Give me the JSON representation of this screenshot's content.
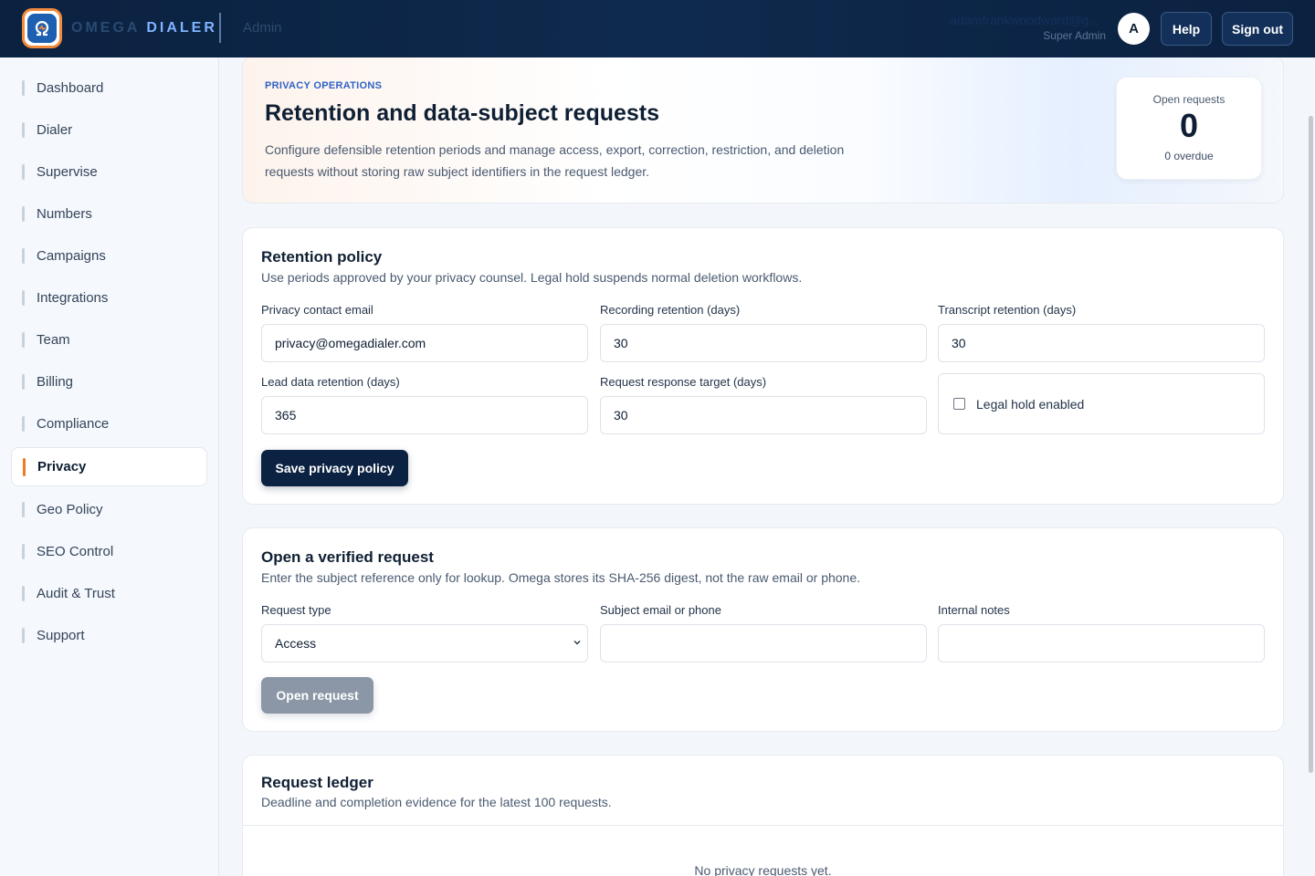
{
  "header": {
    "brand_first": "OMEGA",
    "brand_second": "DIALER",
    "area": "Admin",
    "user_email": "adamfrankwoodward@g...",
    "user_role": "Super Admin",
    "avatar_initial": "A",
    "help_label": "Help",
    "signout_label": "Sign out",
    "accent_color": "#f07b27"
  },
  "sidebar": {
    "items": [
      {
        "label": "Dashboard"
      },
      {
        "label": "Dialer"
      },
      {
        "label": "Supervise"
      },
      {
        "label": "Numbers"
      },
      {
        "label": "Campaigns"
      },
      {
        "label": "Integrations"
      },
      {
        "label": "Team"
      },
      {
        "label": "Billing"
      },
      {
        "label": "Compliance"
      },
      {
        "label": "Privacy",
        "active": true
      },
      {
        "label": "Geo Policy"
      },
      {
        "label": "SEO Control"
      },
      {
        "label": "Audit & Trust"
      },
      {
        "label": "Support"
      }
    ]
  },
  "hero": {
    "eyebrow": "PRIVACY OPERATIONS",
    "title": "Retention and data-subject requests",
    "description": "Configure defensible retention periods and manage access, export, correction, restriction, and deletion requests without storing raw subject identifiers in the request ledger.",
    "stat_label": "Open requests",
    "stat_value": "0",
    "stat_sub": "0 overdue"
  },
  "retention": {
    "title": "Retention policy",
    "subtitle": "Use periods approved by your privacy counsel. Legal hold suspends normal deletion workflows.",
    "contact_label": "Privacy contact email",
    "contact_value": "privacy@omegadialer.com",
    "recording_label": "Recording retention (days)",
    "recording_value": "30",
    "transcript_label": "Transcript retention (days)",
    "transcript_value": "30",
    "lead_label": "Lead data retention (days)",
    "lead_value": "365",
    "response_label": "Request response target (days)",
    "response_value": "30",
    "legal_hold_label": "Legal hold enabled",
    "legal_hold_checked": false,
    "save_label": "Save privacy policy"
  },
  "request_form": {
    "title": "Open a verified request",
    "subtitle": "Enter the subject reference only for lookup. Omega stores its SHA-256 digest, not the raw email or phone.",
    "type_label": "Request type",
    "type_value": "Access",
    "subject_label": "Subject email or phone",
    "subject_value": "",
    "notes_label": "Internal notes",
    "notes_value": "",
    "submit_label": "Open request"
  },
  "ledger": {
    "title": "Request ledger",
    "subtitle": "Deadline and completion evidence for the latest 100 requests.",
    "empty_text": "No privacy requests yet."
  }
}
